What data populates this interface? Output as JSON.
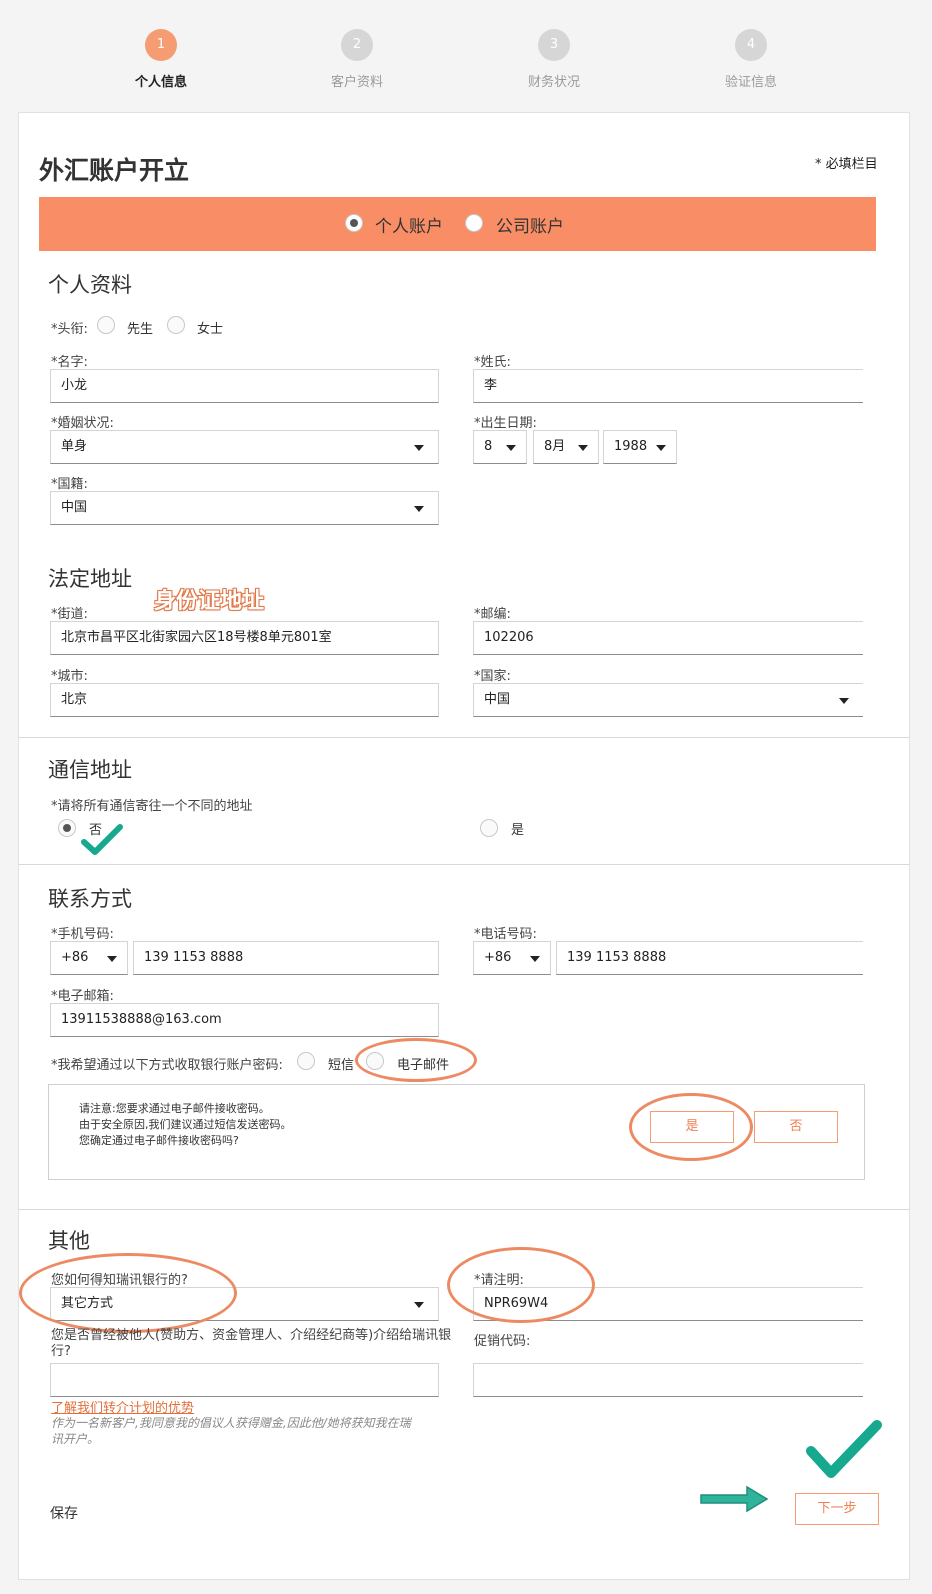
{
  "stepper": [
    {
      "num": "1",
      "label": "个人信息"
    },
    {
      "num": "2",
      "label": "客户资料"
    },
    {
      "num": "3",
      "label": "财务状况"
    },
    {
      "num": "4",
      "label": "验证信息"
    }
  ],
  "header": {
    "title": "外汇账户开立",
    "required_note": "* 必填栏目"
  },
  "account_type": {
    "personal": "个人账户",
    "company": "公司账户",
    "selected": "personal"
  },
  "personal": {
    "section": "个人资料",
    "title_label": "*头衔:",
    "title_options": [
      "先生",
      "女士"
    ],
    "first_name_label": "*名字:",
    "first_name": "小龙",
    "last_name_label": "*姓氏:",
    "last_name": "李",
    "marital_label": "*婚姻状况:",
    "marital": "单身",
    "dob_label": "*出生日期:",
    "dob_day": "8",
    "dob_month": "8月",
    "dob_year": "1988",
    "nationality_label": "*国籍:",
    "nationality": "中国"
  },
  "legal_address": {
    "section": "法定地址",
    "annotation": "身份证地址",
    "street_label": "*街道:",
    "street": "北京市昌平区北街家园六区18号楼8单元801室",
    "zip_label": "*邮编:",
    "zip": "102206",
    "city_label": "*城市:",
    "city": "北京",
    "country_label": "*国家:",
    "country": "中国"
  },
  "mail_address": {
    "section": "通信地址",
    "question": "*请将所有通信寄往一个不同的地址",
    "no": "否",
    "yes": "是"
  },
  "contact": {
    "section": "联系方式",
    "mobile_label": "*手机号码:",
    "mobile_code": "+86",
    "mobile": "139 1153 8888",
    "phone_label": "*电话号码:",
    "phone_code": "+86",
    "phone": "139 1153 8888",
    "email_label": "*电子邮箱:",
    "email": "13911538888@163.com",
    "pwd_label": "*我希望通过以下方式收取银行账户密码:",
    "pwd_sms": "短信",
    "pwd_email": "电子邮件",
    "notice_1": "请注意:您要求通过电子邮件接收密码。",
    "notice_2": "由于安全原因,我们建议通过短信发送密码。",
    "notice_3": "您确定通过电子邮件接收密码吗?",
    "btn_yes": "是",
    "btn_no": "否"
  },
  "other": {
    "section": "其他",
    "source_label": "您如何得知瑞讯银行的?",
    "source": "其它方式",
    "specify_label": "*请注明:",
    "specify": "NPR69W4",
    "referral_label": "您是否曾经被他人(赞助方、资金管理人、介绍经纪商等)介绍给瑞讯银行?",
    "promo_label": "促销代码:",
    "referral_link": "了解我们转介计划的优势",
    "referral_note": "作为一名新客户,我同意我的倡议人获得赠金,因此他/她将获知我在瑞讯开户。"
  },
  "footer": {
    "save": "保存",
    "next": "下一步"
  },
  "colors": {
    "accent": "#f59c73",
    "annotation": "#ec8a63",
    "check": "#17a98e"
  }
}
